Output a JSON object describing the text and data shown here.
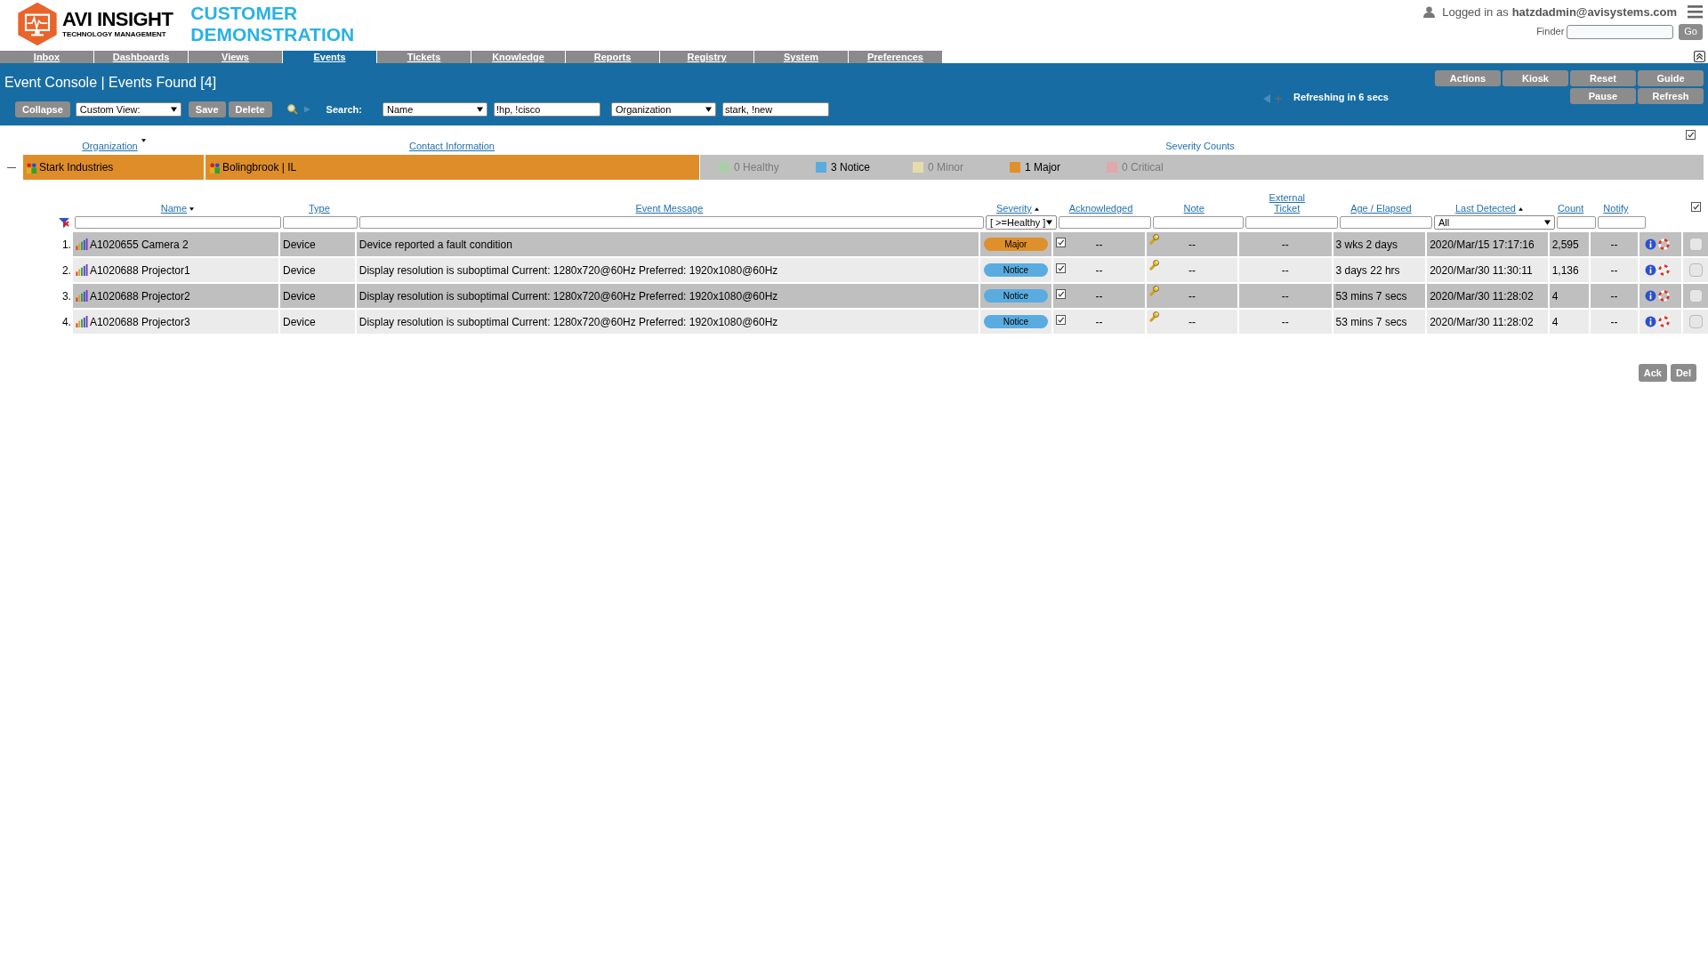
{
  "header": {
    "brand": "AVI INSIGHT",
    "brand_sub": "TECHNOLOGY MANAGEMENT",
    "site_title": [
      "CUSTOMER",
      "DEMONSTRATION"
    ],
    "login_prefix": "Logged in as",
    "login_user": "hatzdadmin@avisystems.com",
    "finder_label": "Finder",
    "finder_button": "Go"
  },
  "tabs": [
    {
      "label": "Inbox",
      "selected": false
    },
    {
      "label": "Dashboards",
      "selected": false
    },
    {
      "label": "Views",
      "selected": false
    },
    {
      "label": "Events",
      "selected": true
    },
    {
      "label": "Tickets",
      "selected": false
    },
    {
      "label": "Knowledge",
      "selected": false
    },
    {
      "label": "Reports",
      "selected": false
    },
    {
      "label": "Registry",
      "selected": false
    },
    {
      "label": "System",
      "selected": false
    },
    {
      "label": "Preferences",
      "selected": false
    }
  ],
  "toolbar": {
    "title": "Event Console | Events Found [4]",
    "collapse": "Collapse",
    "custom_view": "Custom View:",
    "save": "Save",
    "delete": "Delete",
    "search_label": "Search:",
    "filters": [
      {
        "field": "Name",
        "value": "!hp, !cisco"
      },
      {
        "field": "Organization",
        "value": "stark, !new"
      }
    ],
    "buttons_top": [
      "Actions",
      "Kiosk",
      "Reset",
      "Guide"
    ],
    "buttons_bottom": [
      "Pause",
      "Refresh"
    ],
    "refresh_text": "Refreshing in 6 secs"
  },
  "org_table": {
    "columns": [
      "Organization",
      "Contact Information",
      "Severity Counts"
    ],
    "select_all_checked": true,
    "row": {
      "organization": "Stark Industries",
      "contact": "Bolingbrook | IL",
      "severity_counts": [
        {
          "label": "0 Healthy",
          "color": "#a9cfa9",
          "dimmed": true
        },
        {
          "label": "3 Notice",
          "color": "#5aace0",
          "dimmed": false
        },
        {
          "label": "0 Minor",
          "color": "#e6dcaa",
          "dimmed": true
        },
        {
          "label": "1 Major",
          "color": "#e0902a",
          "dimmed": false
        },
        {
          "label": "0 Critical",
          "color": "#e0a8a8",
          "dimmed": true
        }
      ]
    }
  },
  "events_table": {
    "columns": [
      "Name",
      "Type",
      "Event Message",
      "Severity",
      "Acknowledged",
      "Note",
      "External Ticket",
      "Age / Elapsed",
      "Last Detected",
      "Count",
      "Notify"
    ],
    "severity_filter": "[ >=Healthy ]",
    "detected_filter": "All",
    "select_all_checked": true,
    "rows": [
      {
        "index": "1.",
        "name": "A1020655 Camera 2",
        "type": "Device",
        "message": "Device reported a fault condition",
        "severity": "Major",
        "color": "#e0902a",
        "acknowledged": true,
        "ack_text": "--",
        "note": "--",
        "ticket": "--",
        "age": "3 wks 2 days",
        "last_detected": "2020/Mar/15 17:17:16",
        "count": "2,595",
        "notify": "--",
        "checked": false
      },
      {
        "index": "2.",
        "name": "A1020688 Projector1",
        "type": "Device",
        "message": "Display resolution is suboptimal Current: 1280x720@60Hz Preferred: 1920x1080@60Hz",
        "severity": "Notice",
        "color": "#5aace0",
        "acknowledged": true,
        "ack_text": "--",
        "note": "--",
        "ticket": "--",
        "age": "3 days 22 hrs",
        "last_detected": "2020/Mar/30 11:30:11",
        "count": "1,136",
        "notify": "--",
        "checked": false
      },
      {
        "index": "3.",
        "name": "A1020688 Projector2",
        "type": "Device",
        "message": "Display resolution is suboptimal Current: 1280x720@60Hz Preferred: 1920x1080@60Hz",
        "severity": "Notice",
        "color": "#5aace0",
        "acknowledged": true,
        "ack_text": "--",
        "note": "--",
        "ticket": "--",
        "age": "53 mins 7 secs",
        "last_detected": "2020/Mar/30 11:28:02",
        "count": "4",
        "notify": "--",
        "checked": false
      },
      {
        "index": "4.",
        "name": "A1020688 Projector3",
        "type": "Device",
        "message": "Display resolution is suboptimal Current: 1280x720@60Hz Preferred: 1920x1080@60Hz",
        "severity": "Notice",
        "color": "#5aace0",
        "acknowledged": true,
        "ack_text": "--",
        "note": "--",
        "ticket": "--",
        "age": "53 mins 7 secs",
        "last_detected": "2020/Mar/30 11:28:02",
        "count": "4",
        "notify": "--",
        "checked": false
      }
    ]
  },
  "footer_buttons": [
    "Ack",
    "Del"
  ]
}
